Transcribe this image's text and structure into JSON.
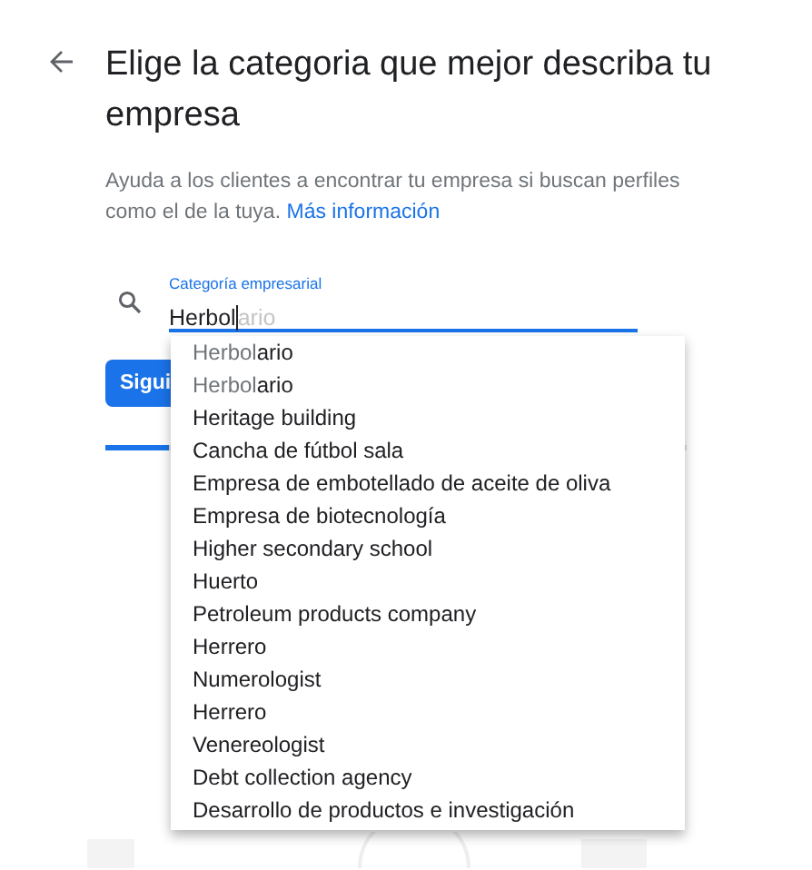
{
  "title": "Elige la categoria que mejor describa tu empresa",
  "description": {
    "text": "Ayuda a los clientes a encontrar tu empresa si buscan perfiles como el de la tuya.",
    "link": "Más información"
  },
  "field": {
    "label": "Categoría empresarial",
    "value": "Herbol",
    "suggestion": "ario"
  },
  "suggestions": [
    {
      "match": "Herbol",
      "rest": "ario"
    },
    {
      "match": "Herbol",
      "rest": "ario"
    },
    {
      "text": "Heritage building"
    },
    {
      "text": "Cancha de fútbol sala"
    },
    {
      "text": "Empresa de embotellado de aceite de oliva"
    },
    {
      "text": "Empresa de biotecnología"
    },
    {
      "text": "Higher secondary school"
    },
    {
      "text": "Huerto"
    },
    {
      "text": "Petroleum products company"
    },
    {
      "text": "Herrero"
    },
    {
      "text": "Numerologist"
    },
    {
      "text": "Herrero"
    },
    {
      "text": "Venereologist"
    },
    {
      "text": "Debt collection agency"
    },
    {
      "text": "Desarrollo de productos e investigación"
    }
  ],
  "button": "Sigui",
  "progress": {
    "level": 0.11
  }
}
